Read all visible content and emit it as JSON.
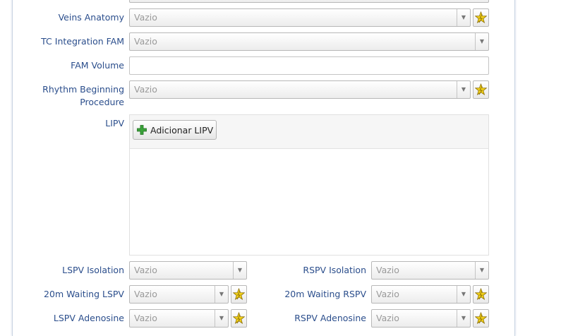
{
  "placeholder": "Vazio",
  "fields": {
    "veins_anatomy": {
      "label": "Veins Anatomy",
      "value": "Vazio"
    },
    "tc_integration_fam": {
      "label": "TC Integration FAM",
      "value": "Vazio"
    },
    "fam_volume": {
      "label": "FAM Volume",
      "value": ""
    },
    "rhythm_beginning": {
      "label_line1": "Rhythm Beginning",
      "label_line2": "Procedure",
      "value": "Vazio"
    },
    "lipv": {
      "label": "LIPV",
      "add_button": "Adicionar LIPV"
    },
    "lspv_isolation": {
      "label": "LSPV Isolation",
      "value": "Vazio"
    },
    "rspv_isolation": {
      "label": "RSPV Isolation",
      "value": "Vazio"
    },
    "waiting_lspv": {
      "label": "20m Waiting LSPV",
      "value": "Vazio"
    },
    "waiting_rspv": {
      "label": "20m Waiting RSPV",
      "value": "Vazio"
    },
    "lspv_adenosine": {
      "label": "LSPV Adenosine",
      "value": "Vazio"
    },
    "rspv_adenosine": {
      "label": "RSPV Adenosine",
      "value": "Vazio"
    }
  },
  "icons": {
    "star": "star-icon",
    "plus": "plus-icon",
    "dropdown": "chevron-down-icon"
  },
  "colors": {
    "label": "#2b4e8c",
    "star": "#f3d21a",
    "plus": "#3aa33a"
  }
}
